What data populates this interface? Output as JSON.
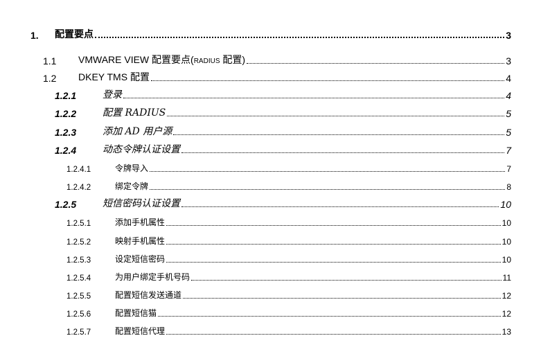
{
  "toc": {
    "entries": [
      {
        "num": "1.",
        "title": "配置要点",
        "page": "3"
      },
      {
        "num": "1.1",
        "title": "VMWARE VIEW 配置要点(",
        "title_sc": "RADIUS",
        "title_end": " 配置)",
        "page": "3"
      },
      {
        "num": "1.2",
        "title": "DKEY TMS 配置",
        "page": "4"
      },
      {
        "num": "1.2.1",
        "title": "登录",
        "page": "4"
      },
      {
        "num": "1.2.2",
        "title": "配置 RADIUS",
        "page": "5"
      },
      {
        "num": "1.2.3",
        "title": "添加 AD 用户源",
        "page": "5"
      },
      {
        "num": "1.2.4",
        "title": "动态令牌认证设置",
        "page": "7"
      },
      {
        "num": "1.2.4.1",
        "title": "令牌导入",
        "page": "7"
      },
      {
        "num": "1.2.4.2",
        "title": "绑定令牌",
        "page": "8"
      },
      {
        "num": "1.2.5",
        "title": "短信密码认证设置",
        "page": "10"
      },
      {
        "num": "1.2.5.1",
        "title": "添加手机属性",
        "page": "10"
      },
      {
        "num": "1.2.5.2",
        "title": "映射手机属性",
        "page": "10"
      },
      {
        "num": "1.2.5.3",
        "title": "设定短信密码",
        "page": "10"
      },
      {
        "num": "1.2.5.4",
        "title": "为用户绑定手机号码",
        "page": "11"
      },
      {
        "num": "1.2.5.5",
        "title": "配置短信发送通道",
        "page": "12"
      },
      {
        "num": "1.2.5.6",
        "title": "配置短信猫",
        "page": "12"
      },
      {
        "num": "1.2.5.7",
        "title": "配置短信代理",
        "page": "13"
      }
    ]
  }
}
